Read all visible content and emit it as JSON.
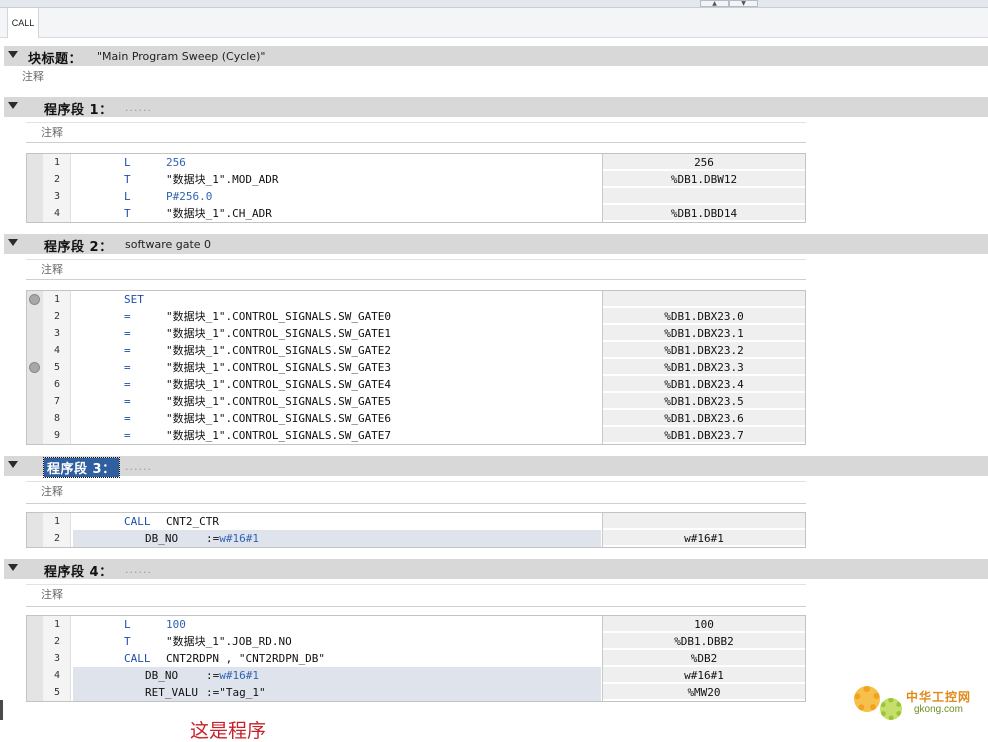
{
  "tab": {
    "label": "CALL"
  },
  "block": {
    "label": "块标题：",
    "title": "\"Main Program Sweep (Cycle)\"",
    "comment": "注释"
  },
  "networks": [
    {
      "label": "程序段 1：",
      "title": "......",
      "comment": "注释",
      "rows": [
        {
          "n": "1",
          "op": "L",
          "arg": "256",
          "arg_kind": "num",
          "val": "256"
        },
        {
          "n": "2",
          "op": "T",
          "arg": "\"数据块_1\".MOD_ADR",
          "arg_kind": "sym",
          "val": "%DB1.DBW12"
        },
        {
          "n": "3",
          "op": "L",
          "arg": "P#256.0",
          "arg_kind": "num",
          "val": ""
        },
        {
          "n": "4",
          "op": "T",
          "arg": "\"数据块_1\".CH_ADR",
          "arg_kind": "sym",
          "val": "%DB1.DBD14"
        }
      ]
    },
    {
      "label": "程序段 2：",
      "title": "software gate 0",
      "comment": "注释",
      "rows": [
        {
          "n": "1",
          "op": "SET",
          "arg": "",
          "arg_kind": "sym",
          "val": "",
          "breakpoint": true
        },
        {
          "n": "2",
          "op": "=",
          "arg": "\"数据块_1\".CONTROL_SIGNALS.SW_GATE0",
          "arg_kind": "sym",
          "val": "%DB1.DBX23.0"
        },
        {
          "n": "3",
          "op": "=",
          "arg": "\"数据块_1\".CONTROL_SIGNALS.SW_GATE1",
          "arg_kind": "sym",
          "val": "%DB1.DBX23.1"
        },
        {
          "n": "4",
          "op": "=",
          "arg": "\"数据块_1\".CONTROL_SIGNALS.SW_GATE2",
          "arg_kind": "sym",
          "val": "%DB1.DBX23.2"
        },
        {
          "n": "5",
          "op": "=",
          "arg": "\"数据块_1\".CONTROL_SIGNALS.SW_GATE3",
          "arg_kind": "sym",
          "val": "%DB1.DBX23.3",
          "breakpoint": true
        },
        {
          "n": "6",
          "op": "=",
          "arg": "\"数据块_1\".CONTROL_SIGNALS.SW_GATE4",
          "arg_kind": "sym",
          "val": "%DB1.DBX23.4"
        },
        {
          "n": "7",
          "op": "=",
          "arg": "\"数据块_1\".CONTROL_SIGNALS.SW_GATE5",
          "arg_kind": "sym",
          "val": "%DB1.DBX23.5"
        },
        {
          "n": "8",
          "op": "=",
          "arg": "\"数据块_1\".CONTROL_SIGNALS.SW_GATE6",
          "arg_kind": "sym",
          "val": "%DB1.DBX23.6"
        },
        {
          "n": "9",
          "op": "=",
          "arg": "\"数据块_1\".CONTROL_SIGNALS.SW_GATE7",
          "arg_kind": "sym",
          "val": "%DB1.DBX23.7"
        }
      ]
    },
    {
      "label": "程序段 3：",
      "title": "......",
      "comment": "注释",
      "selected": true,
      "rows": [
        {
          "n": "1",
          "op": "CALL",
          "arg": "CNT2_CTR",
          "arg_kind": "sym",
          "val": ""
        },
        {
          "n": "2",
          "param": "DB_NO",
          "assign": ":=",
          "pvalue": "w#16#1",
          "val": "w#16#1"
        }
      ]
    },
    {
      "label": "程序段 4：",
      "title": "......",
      "comment": "注释",
      "rows": [
        {
          "n": "1",
          "op": "L",
          "arg": "100",
          "arg_kind": "num",
          "val": "100"
        },
        {
          "n": "2",
          "op": "T",
          "arg": "\"数据块_1\".JOB_RD.NO",
          "arg_kind": "sym",
          "val": "%DB1.DBB2"
        },
        {
          "n": "3",
          "op": "CALL",
          "arg": "CNT2RDPN , \"CNT2RDPN_DB\"",
          "arg_kind": "sym",
          "val": "%DB2"
        },
        {
          "n": "4",
          "param": "DB_NO",
          "assign": ":=",
          "pvalue": "w#16#1",
          "val": "w#16#1"
        },
        {
          "n": "5",
          "param": "RET_VALU",
          "assign": ":=",
          "pvalue": "\"Tag_1\"",
          "pvalue_kind": "sym",
          "val": "%MW20"
        }
      ]
    }
  ],
  "note": "这是程序",
  "watermark": {
    "brand": "中华工控网",
    "site": "gkong.com"
  },
  "colors": {
    "keyword": "#1d4fa8",
    "literal": "#2f63b5",
    "header": "#d8d8d8",
    "note": "#c8202a"
  }
}
